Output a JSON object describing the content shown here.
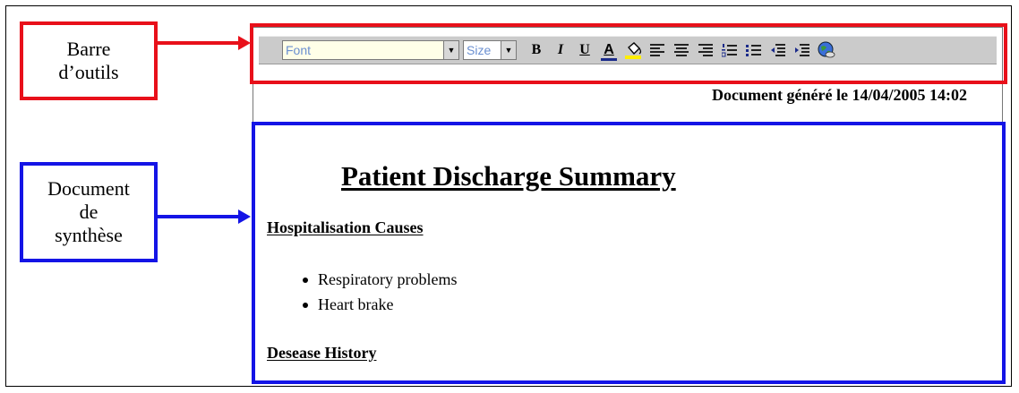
{
  "callouts": {
    "toolbar_label": [
      "Barre",
      "d’outils"
    ],
    "document_label": [
      "Document",
      "de",
      "synthèse"
    ]
  },
  "colors": {
    "toolbar_highlight": "#e8101a",
    "document_highlight": "#1414e6",
    "toolbar_bg": "#cbcbcb"
  },
  "toolbar": {
    "font_select": {
      "value": "Font"
    },
    "size_select": {
      "value": "Size"
    },
    "buttons": [
      {
        "name": "bold-button",
        "icon": "bold-icon",
        "label": "B"
      },
      {
        "name": "italic-button",
        "icon": "italic-icon",
        "label": "I"
      },
      {
        "name": "underline-button",
        "icon": "underline-icon",
        "label": "U"
      },
      {
        "name": "font-color-button",
        "icon": "font-color-icon",
        "label": "A"
      },
      {
        "name": "highlight-color-button",
        "icon": "paint-bucket-icon"
      },
      {
        "name": "align-left-button",
        "icon": "align-left-icon"
      },
      {
        "name": "align-center-button",
        "icon": "align-center-icon"
      },
      {
        "name": "align-right-button",
        "icon": "align-right-icon"
      },
      {
        "name": "numbered-list-button",
        "icon": "numbered-list-icon"
      },
      {
        "name": "bulleted-list-button",
        "icon": "bulleted-list-icon"
      },
      {
        "name": "outdent-button",
        "icon": "outdent-icon"
      },
      {
        "name": "indent-button",
        "icon": "indent-icon"
      },
      {
        "name": "insert-link-button",
        "icon": "globe-link-icon"
      }
    ]
  },
  "document": {
    "generated_text": "Document généré le 14/04/2005 14:02",
    "title": "Patient Discharge Summary",
    "sections": [
      {
        "heading": "Hospitalisation Causes",
        "items": [
          "Respiratory problems",
          "Heart brake"
        ]
      },
      {
        "heading": "Desease History",
        "items": []
      }
    ]
  }
}
